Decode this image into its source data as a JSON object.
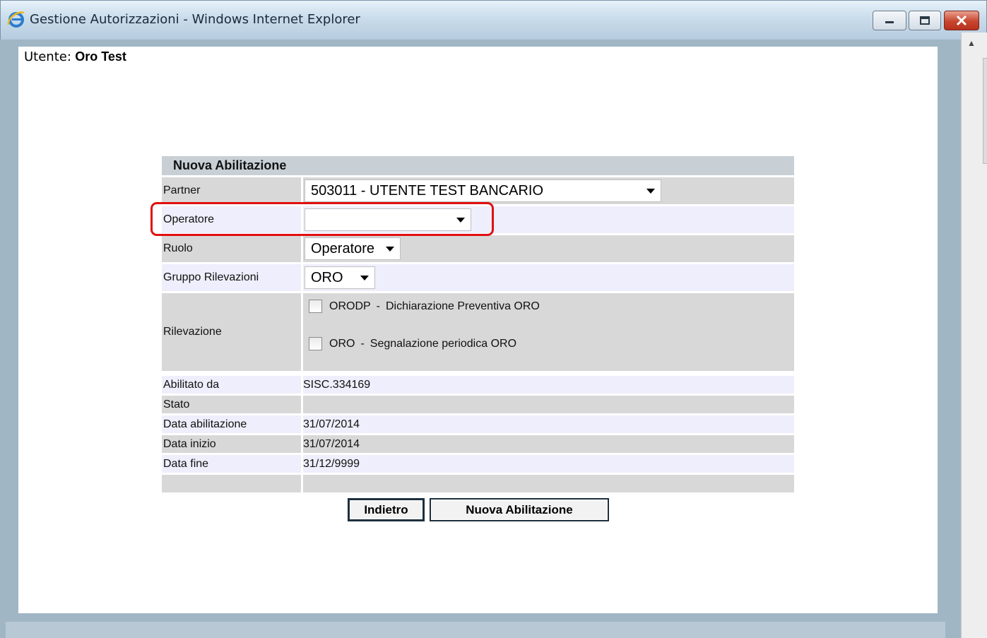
{
  "window": {
    "title": "Gestione Autorizzazioni - Windows Internet Explorer",
    "controls": [
      "minimize",
      "maximize",
      "close"
    ]
  },
  "user": {
    "label": "Utente:",
    "name": "Oro Test"
  },
  "form": {
    "title": "Nuova Abilitazione",
    "partner": {
      "label": "Partner",
      "selected": "503011 - UTENTE TEST BANCARIO"
    },
    "operatore": {
      "label": "Operatore",
      "selected": ""
    },
    "ruolo": {
      "label": "Ruolo",
      "selected": "Operatore"
    },
    "gruppo": {
      "label": "Gruppo Rilevazioni",
      "selected": "ORO"
    },
    "rilevazione": {
      "label": "Rilevazione",
      "items": [
        {
          "code": "ORODP",
          "sep": "-",
          "description": "Dichiarazione Preventiva ORO",
          "checked": false
        },
        {
          "code": "ORO",
          "sep": "-",
          "description": "Segnalazione periodica ORO",
          "checked": false
        }
      ]
    },
    "info": [
      {
        "label": "Abilitato da",
        "value": "SISC.334169"
      },
      {
        "label": "Stato",
        "value": ""
      },
      {
        "label": "Data abilitazione",
        "value": "31/07/2014"
      },
      {
        "label": "Data inizio",
        "value": "31/07/2014"
      },
      {
        "label": "Data fine",
        "value": "31/12/9999"
      },
      {
        "label": "",
        "value": ""
      }
    ]
  },
  "buttons": {
    "back": "Indietro",
    "new": "Nuova Abilitazione"
  },
  "colors": {
    "highlight": "#e01010",
    "header_bg": "#c8d0d6",
    "row_gray": "#d8d8d8",
    "row_lavender": "#eeeefc"
  }
}
